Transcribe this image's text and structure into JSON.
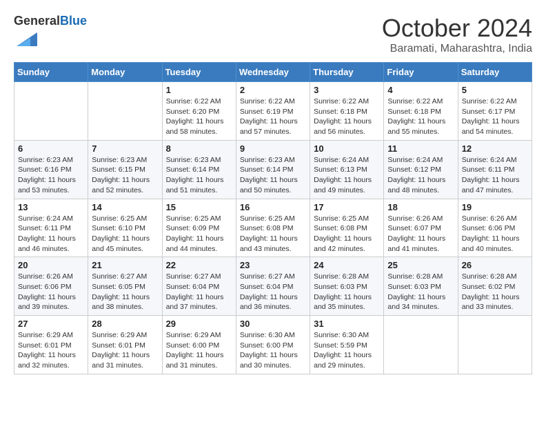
{
  "logo": {
    "general": "General",
    "blue": "Blue"
  },
  "title": "October 2024",
  "location": "Baramati, Maharashtra, India",
  "days_header": [
    "Sunday",
    "Monday",
    "Tuesday",
    "Wednesday",
    "Thursday",
    "Friday",
    "Saturday"
  ],
  "weeks": [
    [
      {
        "num": "",
        "info": ""
      },
      {
        "num": "",
        "info": ""
      },
      {
        "num": "1",
        "info": "Sunrise: 6:22 AM\nSunset: 6:20 PM\nDaylight: 11 hours and 58 minutes."
      },
      {
        "num": "2",
        "info": "Sunrise: 6:22 AM\nSunset: 6:19 PM\nDaylight: 11 hours and 57 minutes."
      },
      {
        "num": "3",
        "info": "Sunrise: 6:22 AM\nSunset: 6:18 PM\nDaylight: 11 hours and 56 minutes."
      },
      {
        "num": "4",
        "info": "Sunrise: 6:22 AM\nSunset: 6:18 PM\nDaylight: 11 hours and 55 minutes."
      },
      {
        "num": "5",
        "info": "Sunrise: 6:22 AM\nSunset: 6:17 PM\nDaylight: 11 hours and 54 minutes."
      }
    ],
    [
      {
        "num": "6",
        "info": "Sunrise: 6:23 AM\nSunset: 6:16 PM\nDaylight: 11 hours and 53 minutes."
      },
      {
        "num": "7",
        "info": "Sunrise: 6:23 AM\nSunset: 6:15 PM\nDaylight: 11 hours and 52 minutes."
      },
      {
        "num": "8",
        "info": "Sunrise: 6:23 AM\nSunset: 6:14 PM\nDaylight: 11 hours and 51 minutes."
      },
      {
        "num": "9",
        "info": "Sunrise: 6:23 AM\nSunset: 6:14 PM\nDaylight: 11 hours and 50 minutes."
      },
      {
        "num": "10",
        "info": "Sunrise: 6:24 AM\nSunset: 6:13 PM\nDaylight: 11 hours and 49 minutes."
      },
      {
        "num": "11",
        "info": "Sunrise: 6:24 AM\nSunset: 6:12 PM\nDaylight: 11 hours and 48 minutes."
      },
      {
        "num": "12",
        "info": "Sunrise: 6:24 AM\nSunset: 6:11 PM\nDaylight: 11 hours and 47 minutes."
      }
    ],
    [
      {
        "num": "13",
        "info": "Sunrise: 6:24 AM\nSunset: 6:11 PM\nDaylight: 11 hours and 46 minutes."
      },
      {
        "num": "14",
        "info": "Sunrise: 6:25 AM\nSunset: 6:10 PM\nDaylight: 11 hours and 45 minutes."
      },
      {
        "num": "15",
        "info": "Sunrise: 6:25 AM\nSunset: 6:09 PM\nDaylight: 11 hours and 44 minutes."
      },
      {
        "num": "16",
        "info": "Sunrise: 6:25 AM\nSunset: 6:08 PM\nDaylight: 11 hours and 43 minutes."
      },
      {
        "num": "17",
        "info": "Sunrise: 6:25 AM\nSunset: 6:08 PM\nDaylight: 11 hours and 42 minutes."
      },
      {
        "num": "18",
        "info": "Sunrise: 6:26 AM\nSunset: 6:07 PM\nDaylight: 11 hours and 41 minutes."
      },
      {
        "num": "19",
        "info": "Sunrise: 6:26 AM\nSunset: 6:06 PM\nDaylight: 11 hours and 40 minutes."
      }
    ],
    [
      {
        "num": "20",
        "info": "Sunrise: 6:26 AM\nSunset: 6:06 PM\nDaylight: 11 hours and 39 minutes."
      },
      {
        "num": "21",
        "info": "Sunrise: 6:27 AM\nSunset: 6:05 PM\nDaylight: 11 hours and 38 minutes."
      },
      {
        "num": "22",
        "info": "Sunrise: 6:27 AM\nSunset: 6:04 PM\nDaylight: 11 hours and 37 minutes."
      },
      {
        "num": "23",
        "info": "Sunrise: 6:27 AM\nSunset: 6:04 PM\nDaylight: 11 hours and 36 minutes."
      },
      {
        "num": "24",
        "info": "Sunrise: 6:28 AM\nSunset: 6:03 PM\nDaylight: 11 hours and 35 minutes."
      },
      {
        "num": "25",
        "info": "Sunrise: 6:28 AM\nSunset: 6:03 PM\nDaylight: 11 hours and 34 minutes."
      },
      {
        "num": "26",
        "info": "Sunrise: 6:28 AM\nSunset: 6:02 PM\nDaylight: 11 hours and 33 minutes."
      }
    ],
    [
      {
        "num": "27",
        "info": "Sunrise: 6:29 AM\nSunset: 6:01 PM\nDaylight: 11 hours and 32 minutes."
      },
      {
        "num": "28",
        "info": "Sunrise: 6:29 AM\nSunset: 6:01 PM\nDaylight: 11 hours and 31 minutes."
      },
      {
        "num": "29",
        "info": "Sunrise: 6:29 AM\nSunset: 6:00 PM\nDaylight: 11 hours and 31 minutes."
      },
      {
        "num": "30",
        "info": "Sunrise: 6:30 AM\nSunset: 6:00 PM\nDaylight: 11 hours and 30 minutes."
      },
      {
        "num": "31",
        "info": "Sunrise: 6:30 AM\nSunset: 5:59 PM\nDaylight: 11 hours and 29 minutes."
      },
      {
        "num": "",
        "info": ""
      },
      {
        "num": "",
        "info": ""
      }
    ]
  ]
}
